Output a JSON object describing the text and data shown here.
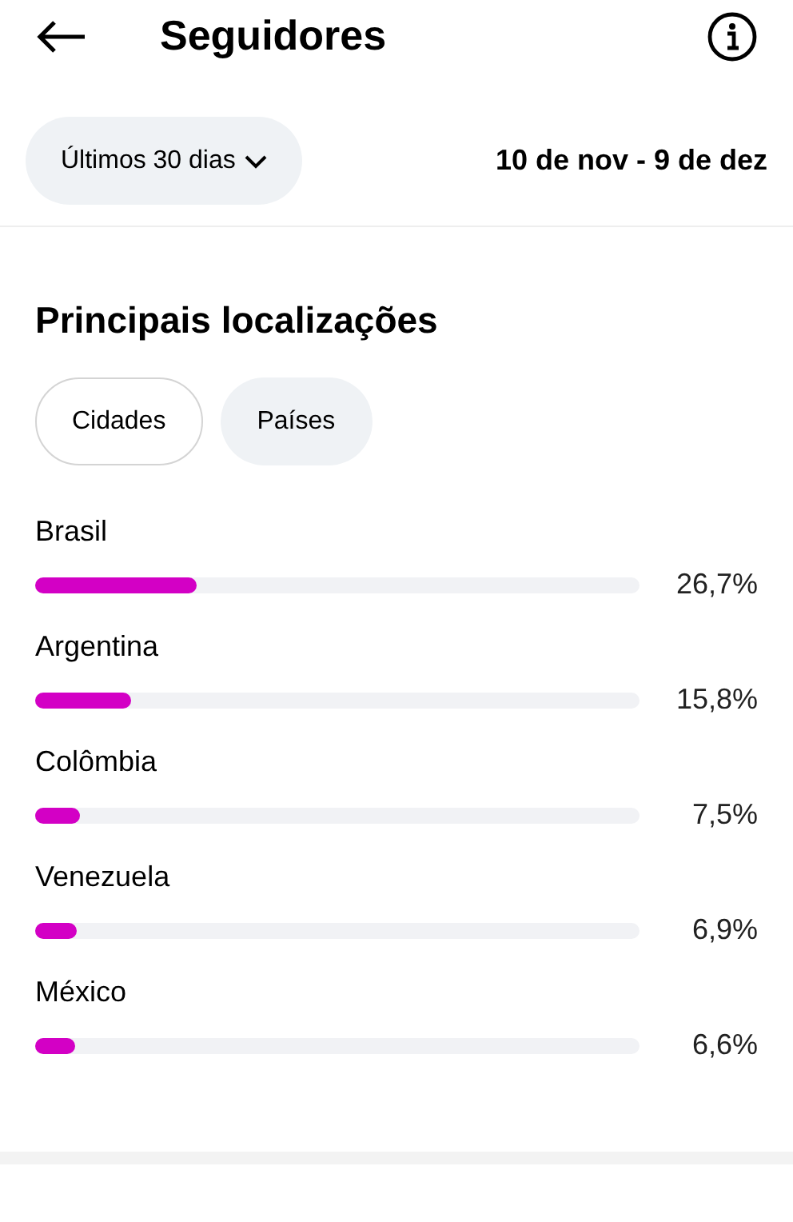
{
  "header": {
    "title": "Seguidores"
  },
  "filter": {
    "period": "Últimos 30 dias",
    "range": "10 de nov - 9 de dez"
  },
  "section": {
    "title": "Principais localizações"
  },
  "tabs": [
    {
      "label": "Cidades",
      "selected": false
    },
    {
      "label": "Países",
      "selected": true
    }
  ],
  "locations": [
    {
      "name": "Brasil",
      "level": 0.267,
      "reading": "26,7%"
    },
    {
      "name": "Argentina",
      "level": 0.158,
      "reading": "15,8%"
    },
    {
      "name": "Colômbia",
      "level": 0.075,
      "reading": "7,5%"
    },
    {
      "name": "Venezuela",
      "level": 0.069,
      "reading": "6,9%"
    },
    {
      "name": "México",
      "level": 0.066,
      "reading": "6,6%"
    }
  ]
}
